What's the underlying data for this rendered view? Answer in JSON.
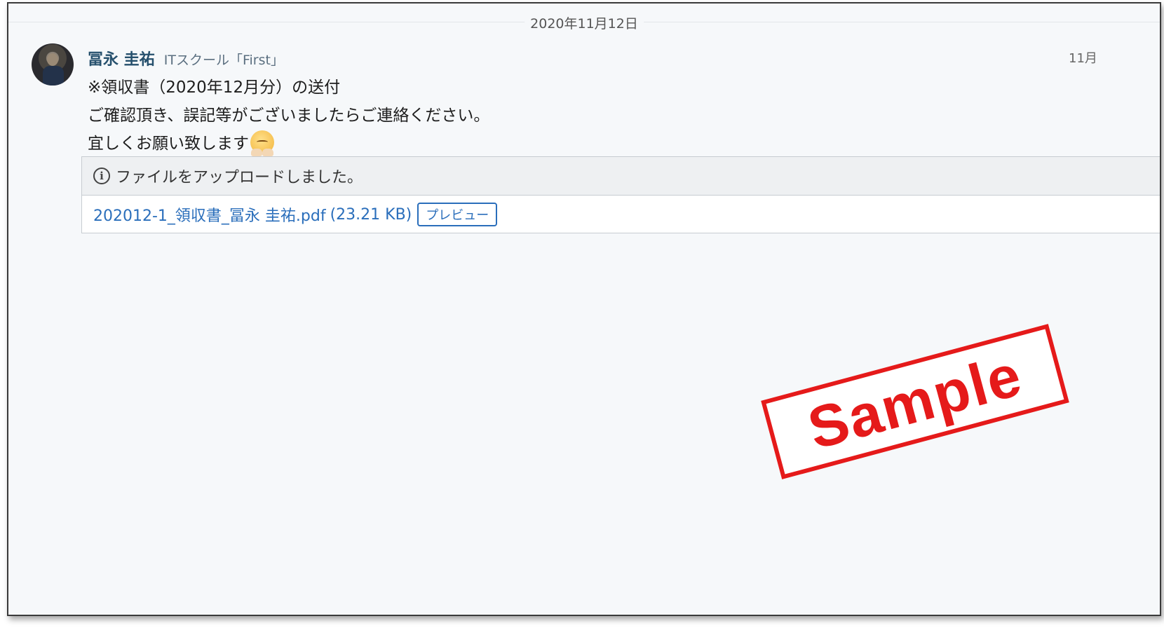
{
  "date_separator": "2020年11月12日",
  "message": {
    "sender": "冨永 圭祐",
    "organization": "ITスクール「First」",
    "time": "11月",
    "lines": [
      "※領収書（2020年12月分）の送付",
      "ご確認頂き、誤記等がございましたらご連絡ください。",
      "宜しくお願い致します"
    ],
    "emoji": "bowing-face-emoji"
  },
  "attachment": {
    "header": "ファイルをアップロードしました。",
    "file_name": "202012-1_領収書_冨永 圭祐.pdf",
    "file_size": "(23.21 KB)",
    "preview_label": "プレビュー"
  },
  "watermark": "Sample",
  "colors": {
    "sender": "#26506d",
    "link": "#2a6ebb",
    "stamp": "#e51a1a",
    "background": "#f6f8fa"
  }
}
